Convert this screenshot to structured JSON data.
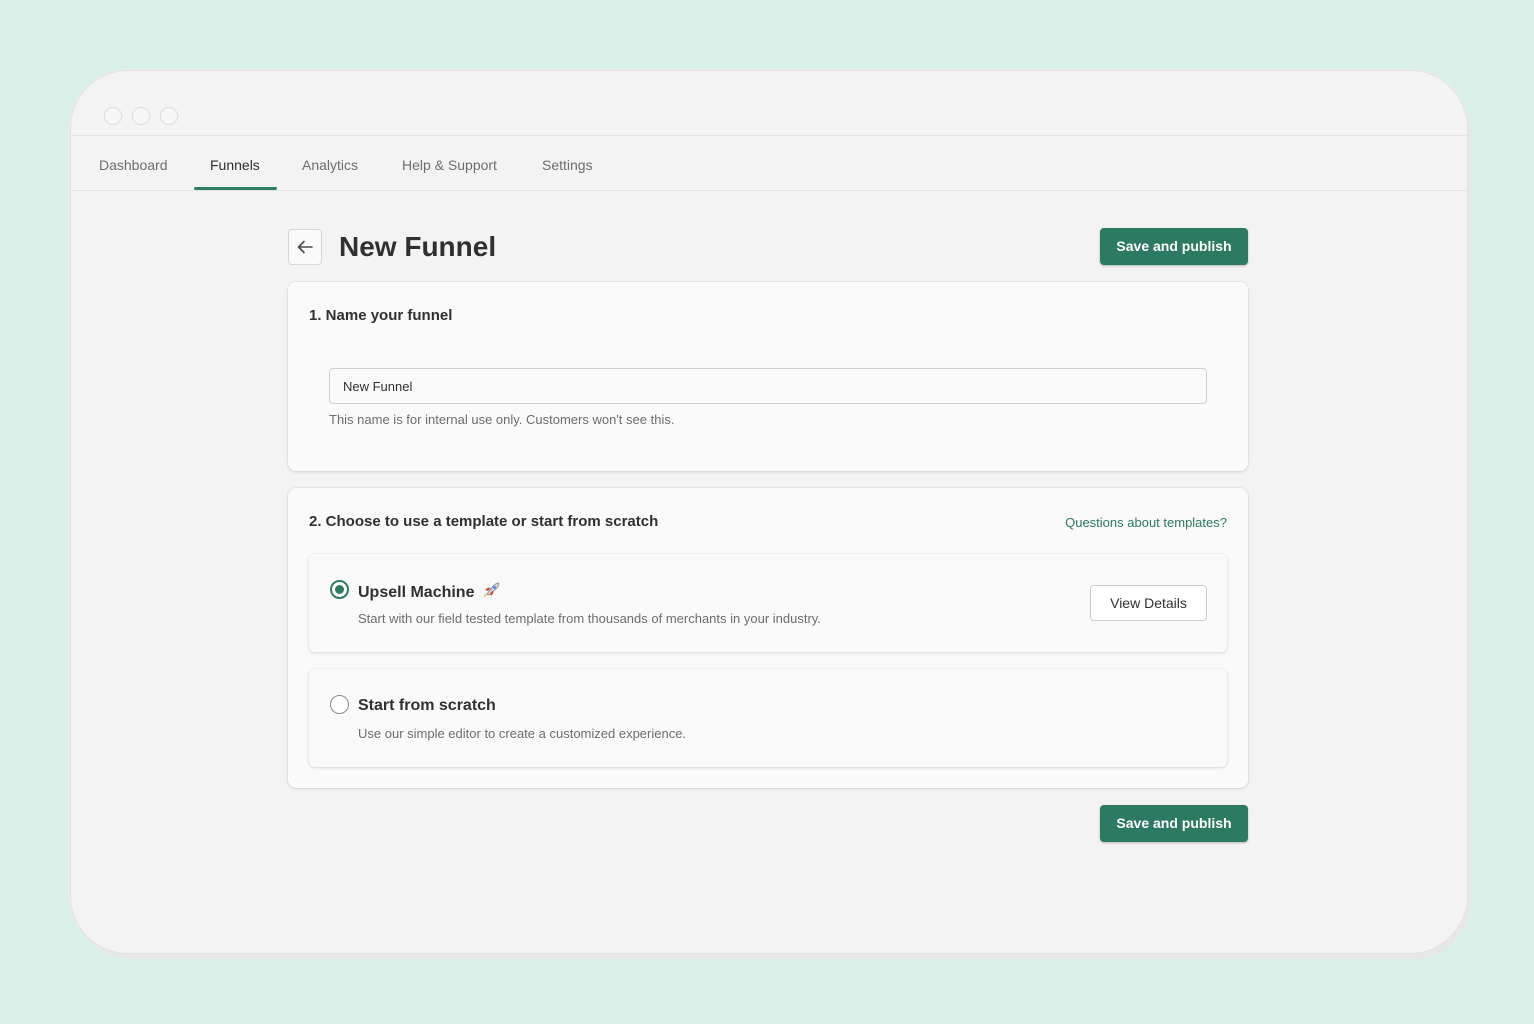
{
  "nav": {
    "tabs": [
      {
        "label": "Dashboard"
      },
      {
        "label": "Funnels"
      },
      {
        "label": "Analytics"
      },
      {
        "label": "Help & Support"
      },
      {
        "label": "Settings"
      }
    ],
    "active_tab": "Funnels"
  },
  "header": {
    "title": "New Funnel",
    "save_label": "Save and publish"
  },
  "section1": {
    "title": "1. Name your funnel",
    "input_value": "New Funnel",
    "help_text": "This name is for internal use only. Customers won't see this."
  },
  "section2": {
    "title": "2. Choose to use a template or start from scratch",
    "link": "Questions about templates?",
    "options": [
      {
        "title": "Upsell Machine",
        "description": "Start with our field tested template from thousands of merchants in your industry.",
        "selected": true,
        "icon": "rocket-icon",
        "button_label": "View Details"
      },
      {
        "title": "Start from scratch",
        "description": "Use our simple editor to create a customized experience.",
        "selected": false
      }
    ]
  },
  "footer": {
    "save_label": "Save and publish"
  },
  "colors": {
    "background": "#d9f0e8",
    "accent": "#2d7a63",
    "window": "#f3f3f3"
  }
}
